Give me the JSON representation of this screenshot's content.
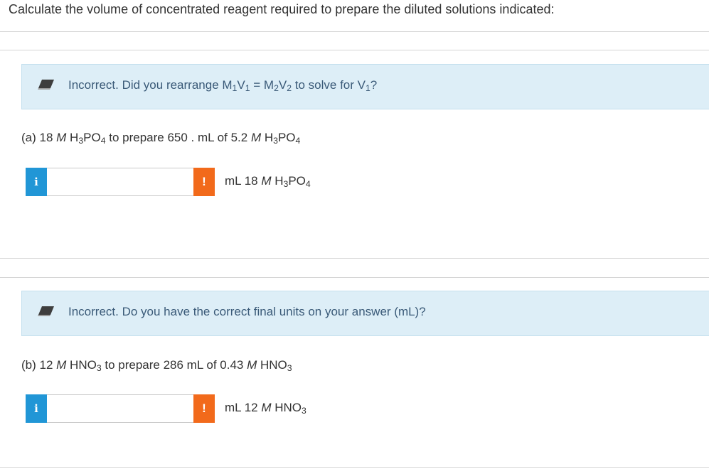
{
  "instructions": "Calculate the volume of concentrated reagent required to prepare the diluted solutions indicated:",
  "parts": [
    {
      "feedback": {
        "icon": "eraser-icon",
        "prefix": "Incorrect. Did you rearrange M",
        "s1": "1",
        "v1": "V",
        "s2": "1",
        "eq": " = M",
        "s3": "2",
        "v2": "V",
        "s4": "2",
        "mid": " to solve for V",
        "s5": "1",
        "end": "?"
      },
      "question": {
        "a": "(a) 18 ",
        "m1": "M",
        "b": " H",
        "s1": "3",
        "c": "PO",
        "s2": "4",
        "d": " to prepare 650 . mL of 5.2 ",
        "m2": "M",
        "e": " H",
        "s3": "3",
        "f": "PO",
        "s4": "4"
      },
      "answer_value": "",
      "info_label": "i",
      "warn_label": "!",
      "unit": {
        "a": "mL 18 ",
        "m": "M",
        "b": " H",
        "s1": "3",
        "c": "PO",
        "s2": "4"
      }
    },
    {
      "feedback": {
        "icon": "eraser-icon",
        "text": "Incorrect. Do you have the correct final units on your answer (mL)?"
      },
      "question": {
        "a": "(b) 12 ",
        "m1": "M",
        "b": " HNO",
        "s1": "3",
        "c": " to prepare 286 mL of 0.43 ",
        "m2": "M",
        "d": " HNO",
        "s2": "3"
      },
      "answer_value": "",
      "info_label": "i",
      "warn_label": "!",
      "unit": {
        "a": "mL 12 ",
        "m": "M",
        "b": " HNO",
        "s1": "3"
      }
    }
  ],
  "colors": {
    "feedback_bg": "#ddeef7",
    "info_button": "#2196d6",
    "warning_button": "#f26a1b"
  }
}
